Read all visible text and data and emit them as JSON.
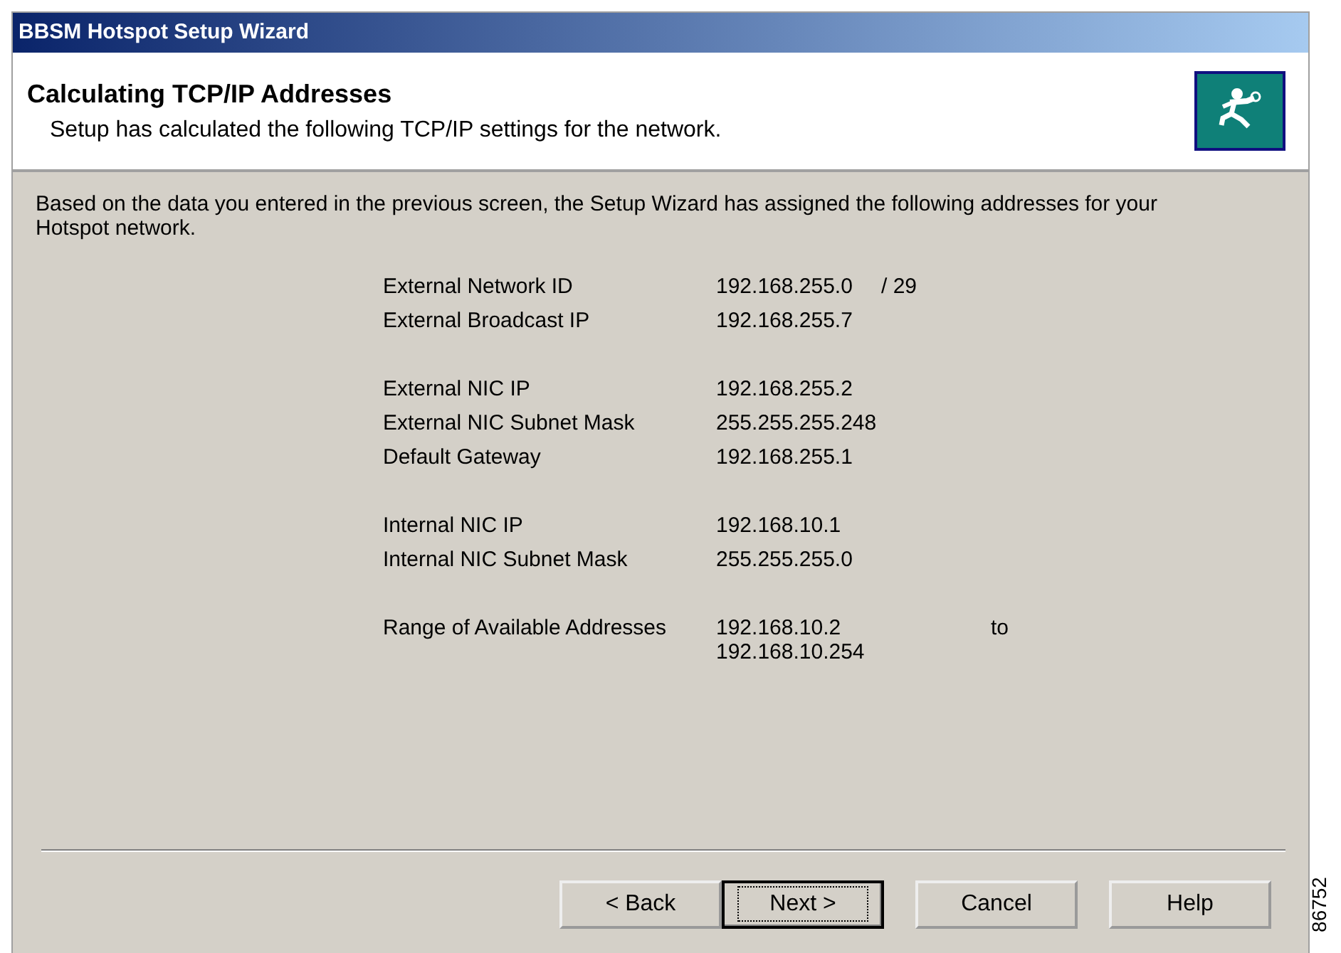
{
  "window": {
    "title": "BBSM Hotspot Setup Wizard"
  },
  "header": {
    "title": "Calculating TCP/IP Addresses",
    "subtitle": "Setup has calculated the following TCP/IP settings for the network."
  },
  "intro": "Based on the data you entered in the previous screen, the Setup Wizard has assigned the following addresses for your Hotspot network.",
  "groups": [
    {
      "rows": [
        {
          "label": "External Network ID",
          "value": "192.168.255.0",
          "extra": "/  29"
        },
        {
          "label": "External Broadcast IP",
          "value": "192.168.255.7"
        }
      ]
    },
    {
      "rows": [
        {
          "label": "External NIC IP",
          "value": "192.168.255.2"
        },
        {
          "label": "External NIC Subnet Mask",
          "value": "255.255.255.248"
        },
        {
          "label": "Default Gateway",
          "value": "192.168.255.1"
        }
      ]
    },
    {
      "rows": [
        {
          "label": "Internal NIC IP",
          "value": "192.168.10.1"
        },
        {
          "label": "Internal NIC Subnet Mask",
          "value": "255.255.255.0"
        }
      ]
    },
    {
      "rows": [
        {
          "label": "Range of Available Addresses",
          "value": "192.168.10.2",
          "extra": "to",
          "value_2": "192.168.10.254"
        }
      ]
    }
  ],
  "buttons": [
    {
      "label": "< Back",
      "selected": false
    },
    {
      "label": "Next >",
      "selected": true
    },
    {
      "label": "Cancel",
      "selected": false
    },
    {
      "label": "Help",
      "selected": false
    }
  ],
  "figure_number": "86752"
}
